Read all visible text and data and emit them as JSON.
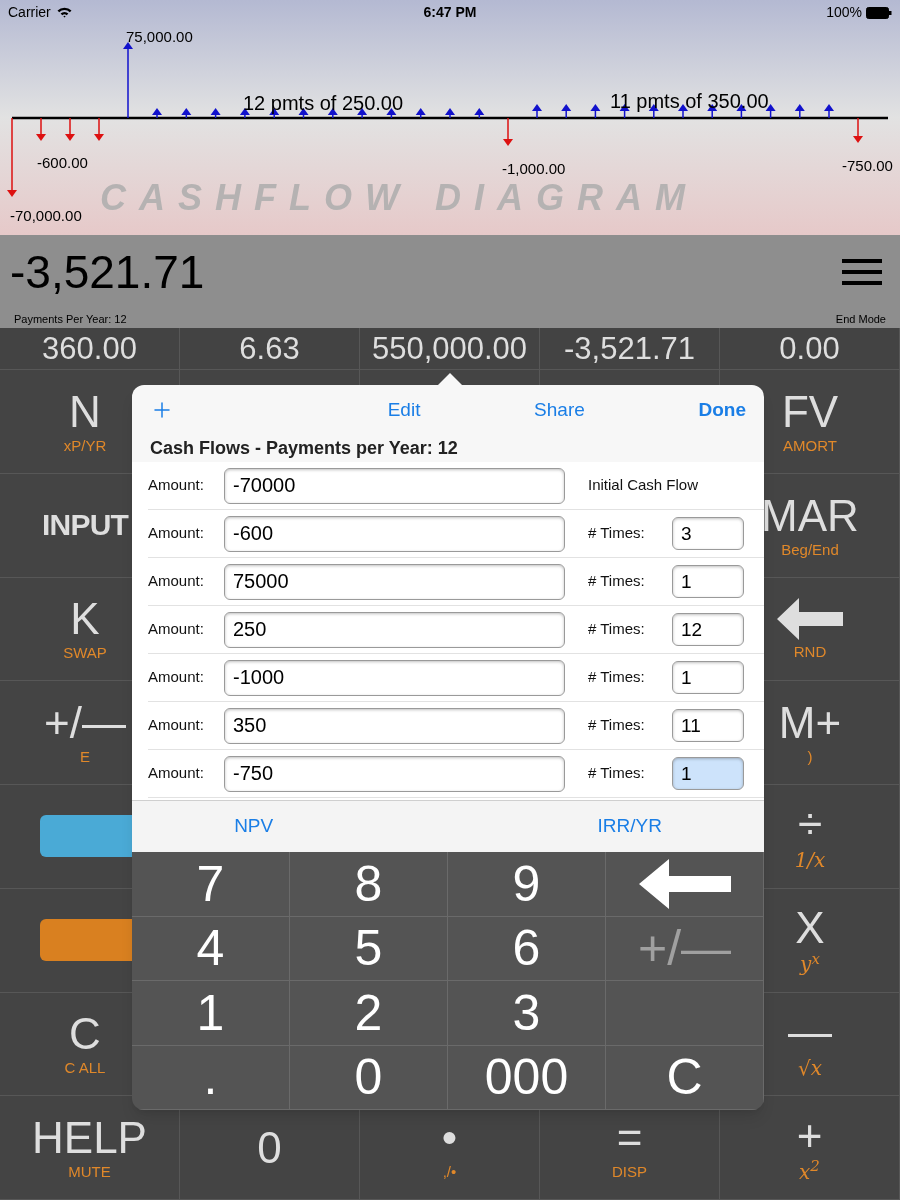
{
  "status_bar": {
    "carrier": "Carrier",
    "time": "6:47 PM",
    "battery": "100%"
  },
  "diagram": {
    "watermark": "CASHFLOW DIAGRAM",
    "labels": [
      "75,000.00",
      "12 pmts of 250.00",
      "11 pmts of 350.00",
      "-600.00",
      "-1,000.00",
      "-750.00",
      "-70,000.00"
    ]
  },
  "display": {
    "value": "-3,521.71",
    "left_note": "Payments Per Year: 12",
    "right_note": "End Mode"
  },
  "registers": [
    "360.00",
    "6.63",
    "550,000.00",
    "-3,521.71",
    "0.00"
  ],
  "keys": {
    "left": [
      {
        "kind": "text",
        "main": "N",
        "sub": "xP/YR",
        "math": false
      },
      {
        "kind": "text",
        "main": "INPUT"
      },
      {
        "kind": "text",
        "main": "K",
        "sub": "SWAP",
        "math": false
      },
      {
        "kind": "text",
        "main": "+/—",
        "sub": "E",
        "math": false
      },
      {
        "kind": "bar",
        "color": "#4aaad6"
      },
      {
        "kind": "bar",
        "color": "#d98020"
      },
      {
        "kind": "text",
        "main": "C",
        "sub": "C ALL",
        "math": false
      },
      {
        "kind": "text",
        "main": "HELP",
        "sub": "MUTE",
        "math": false
      }
    ],
    "right": [
      {
        "kind": "text",
        "main": "FV",
        "sub": "AMORT",
        "math": false
      },
      {
        "kind": "text",
        "main": "MAR",
        "sub": "Beg/End",
        "math": false
      },
      {
        "kind": "arrow",
        "sub": "RND",
        "math": false
      },
      {
        "kind": "text",
        "main": "M+",
        "sub": ")",
        "math": false
      },
      {
        "kind": "text",
        "main": "÷",
        "sub": "1/x",
        "math": true
      },
      {
        "kind": "text",
        "main": "X",
        "sub": "y$^{x}$",
        "math": true
      },
      {
        "kind": "text",
        "main": "—",
        "sub": "√x",
        "math": true
      },
      {
        "kind": "text",
        "main": "+",
        "sub": "x$^{2}$",
        "math": true
      }
    ],
    "bottom": [
      {
        "kind": "text",
        "main": "0"
      },
      {
        "kind": "text",
        "main": "•",
        "sub": ",/•",
        "math": false
      },
      {
        "kind": "text",
        "main": "=",
        "sub": "DISP",
        "math": false
      }
    ]
  },
  "popover": {
    "toolbar": [
      {
        "label": "Edit",
        "primary": false
      },
      {
        "label": "Share",
        "primary": false
      },
      {
        "label": "Done",
        "primary": true
      }
    ],
    "title": "Cash Flows - Payments per Year: 12",
    "rows": [
      {
        "kind": "initial",
        "label": "Amount:",
        "amount": "-70000",
        "note": "Initial Cash Flow"
      },
      {
        "kind": "repeat",
        "label": "Amount:",
        "amount": "-600",
        "times_label": "# Times:",
        "times": "3",
        "focused": false
      },
      {
        "kind": "repeat",
        "label": "Amount:",
        "amount": "75000",
        "times_label": "# Times:",
        "times": "1",
        "focused": false
      },
      {
        "kind": "repeat",
        "label": "Amount:",
        "amount": "250",
        "times_label": "# Times:",
        "times": "12",
        "focused": false
      },
      {
        "kind": "repeat",
        "label": "Amount:",
        "amount": "-1000",
        "times_label": "# Times:",
        "times": "1",
        "focused": false
      },
      {
        "kind": "repeat",
        "label": "Amount:",
        "amount": "350",
        "times_label": "# Times:",
        "times": "11",
        "focused": false
      },
      {
        "kind": "repeat",
        "label": "Amount:",
        "amount": "-750",
        "times_label": "# Times:",
        "times": "1",
        "focused": true
      }
    ],
    "actions": [
      "NPV",
      "IRR/YR"
    ],
    "keypad": [
      {
        "kind": "digit",
        "label": "7",
        "disabled": false
      },
      {
        "kind": "digit",
        "label": "8",
        "disabled": false
      },
      {
        "kind": "digit",
        "label": "9",
        "disabled": false
      },
      {
        "kind": "backspace",
        "disabled": false
      },
      {
        "kind": "digit",
        "label": "4",
        "disabled": false
      },
      {
        "kind": "digit",
        "label": "5",
        "disabled": false
      },
      {
        "kind": "digit",
        "label": "6",
        "disabled": false
      },
      {
        "kind": "digit",
        "label": "+/—",
        "disabled": true
      },
      {
        "kind": "digit",
        "label": "1",
        "disabled": false
      },
      {
        "kind": "digit",
        "label": "2",
        "disabled": false
      },
      {
        "kind": "digit",
        "label": "3",
        "disabled": false
      },
      {
        "kind": "blank"
      },
      {
        "kind": "digit",
        "label": ".",
        "disabled": false
      },
      {
        "kind": "digit",
        "label": "0",
        "disabled": false
      },
      {
        "kind": "digit",
        "label": "000",
        "disabled": false
      },
      {
        "kind": "digit",
        "label": "C",
        "disabled": false
      }
    ]
  }
}
